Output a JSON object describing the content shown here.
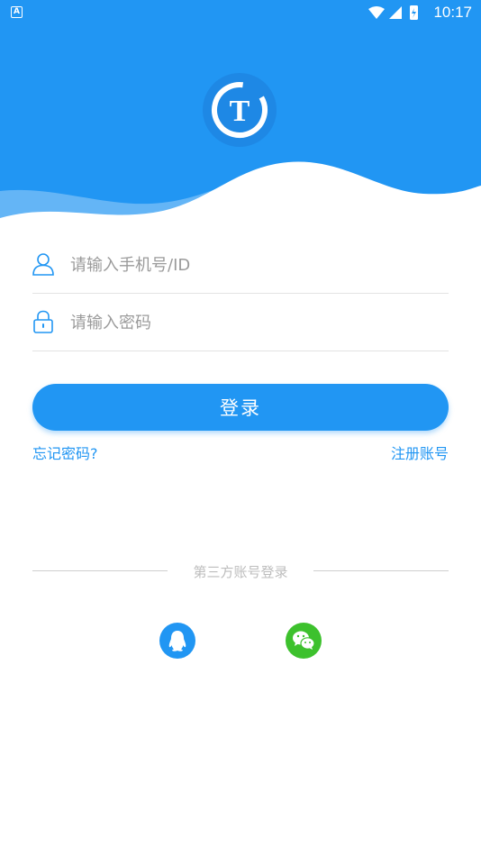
{
  "status_bar": {
    "notification_icon": "app-notification-icon",
    "time": "10:17"
  },
  "header": {
    "logo_letter": "T",
    "brand_color": "#2196F3"
  },
  "form": {
    "phone_placeholder": "请输入手机号/ID",
    "password_placeholder": "请输入密码",
    "phone_value": "",
    "password_value": ""
  },
  "actions": {
    "login_label": "登录",
    "forgot_label": "忘记密码?",
    "register_label": "注册账号"
  },
  "third_party": {
    "title": "第三方账号登录",
    "providers": [
      "qq-icon",
      "wechat-icon"
    ]
  }
}
